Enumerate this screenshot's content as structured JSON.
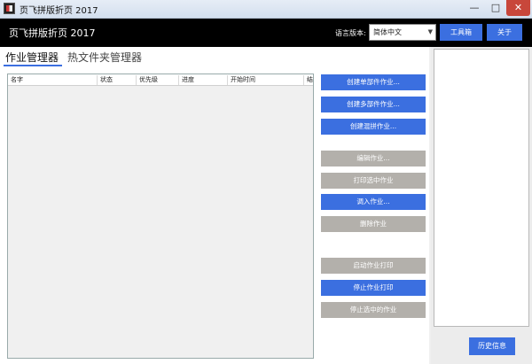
{
  "window": {
    "title": "页飞拼版折页 2017",
    "minimize_icon": "minimize-icon",
    "maximize_icon": "maximize-icon",
    "close_icon": "close-icon"
  },
  "header": {
    "brand": "页飞拼版折页 2017",
    "language_label": "语言版本:",
    "language_value": "简体中文",
    "toolbox_label": "工具箱",
    "about_label": "关于"
  },
  "tabs": [
    {
      "label": "作业管理器",
      "active": true
    },
    {
      "label": "热文件夹管理器",
      "active": false
    }
  ],
  "table": {
    "columns": [
      "名字",
      "状态",
      "优先级",
      "进度",
      "开始时间",
      "结束"
    ],
    "rows": []
  },
  "actions": [
    {
      "label": "创建单部件作业...",
      "enabled": true
    },
    {
      "label": "创建多部件作业...",
      "enabled": true
    },
    {
      "label": "创建混拼作业...",
      "enabled": true
    },
    {
      "label": "编辑作业...",
      "enabled": false
    },
    {
      "label": "打印选中作业",
      "enabled": false
    },
    {
      "label": "调入作业...",
      "enabled": true
    },
    {
      "label": "删除作业",
      "enabled": false
    },
    {
      "label": "启动作业打印",
      "enabled": false
    },
    {
      "label": "停止作业打印",
      "enabled": true
    },
    {
      "label": "停止选中的作业",
      "enabled": false
    }
  ],
  "right_panel": {
    "history_label": "历史信息"
  },
  "colors": {
    "accent": "#3b6fe0",
    "disabled": "#b3b0ab",
    "header_bg": "#000000",
    "close_button": "#c8473b"
  }
}
